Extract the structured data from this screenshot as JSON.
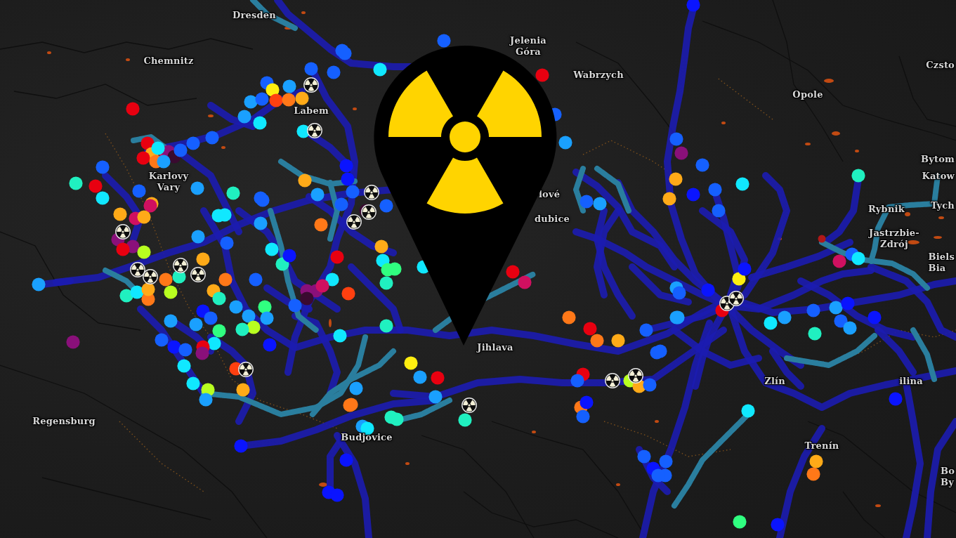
{
  "map": {
    "labels": [
      {
        "lines": [
          "Dresden"
        ]
      },
      {
        "lines": [
          "Jelenia",
          "Góra"
        ]
      },
      {
        "lines": [
          "Chemnitz"
        ]
      },
      {
        "lines": [
          "Wabrzych"
        ]
      },
      {
        "lines": [
          "Czsto"
        ]
      },
      {
        "lines": [
          "Opole"
        ]
      },
      {
        "lines": [
          "Labem"
        ]
      },
      {
        "lines": [
          "Bytom"
        ]
      },
      {
        "lines": [
          "Katow"
        ]
      },
      {
        "lines": [
          "Karlovy",
          "Vary"
        ]
      },
      {
        "lines": [
          "lové"
        ]
      },
      {
        "lines": [
          "Tych"
        ]
      },
      {
        "lines": [
          "Rybnik"
        ]
      },
      {
        "lines": [
          "dubice"
        ]
      },
      {
        "lines": [
          "Jastrzbie-",
          "Zdrój"
        ]
      },
      {
        "lines": [
          "Biels",
          "Bia"
        ]
      },
      {
        "lines": [
          "Jihlava"
        ]
      },
      {
        "lines": [
          "Zlín"
        ]
      },
      {
        "lines": [
          "ilina"
        ]
      },
      {
        "lines": [
          "Regensburg"
        ]
      },
      {
        "lines": [
          "Budjovice"
        ]
      },
      {
        "lines": [
          "Trenín"
        ]
      },
      {
        "lines": [
          "Bo",
          "By"
        ]
      }
    ]
  }
}
